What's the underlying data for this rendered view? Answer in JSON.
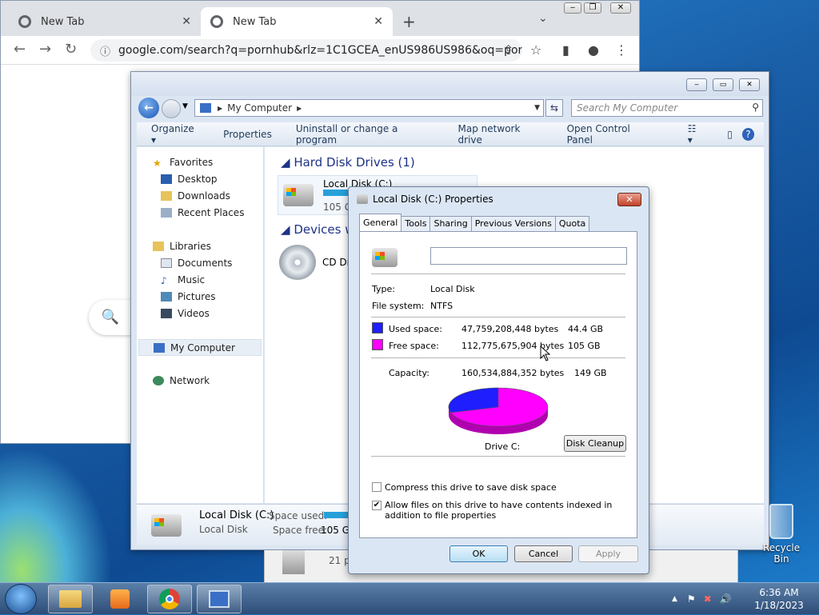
{
  "browser": {
    "tabs": [
      {
        "title": "New Tab"
      },
      {
        "title": "New Tab"
      }
    ],
    "address": "google.com/search?q=pornhub&rlz=1C1GCEA_enUS986US986&oq=porn..."
  },
  "explorer": {
    "breadcrumb": "My Computer",
    "search_placeholder": "Search My Computer",
    "commands": [
      "Organize",
      "Properties",
      "Uninstall or change a program",
      "Map network drive",
      "Open Control Panel"
    ],
    "nav": {
      "favorites": "Favorites",
      "desktop": "Desktop",
      "downloads": "Downloads",
      "recent": "Recent Places",
      "libraries": "Libraries",
      "documents": "Documents",
      "music": "Music",
      "pictures": "Pictures",
      "videos": "Videos",
      "computer": "My Computer",
      "network": "Network"
    },
    "groups": {
      "hdd": "Hard Disk Drives (1)",
      "removable": "Devices with"
    },
    "drive_c": {
      "name": "Local Disk (C:)",
      "size": "105 GB"
    },
    "cd_drive": "CD Dri",
    "details": {
      "name": "Local Disk (C:)",
      "type": "Local Disk",
      "used_label": "Space used:",
      "free_label": "Space free:",
      "free_value": "105 GB"
    },
    "peek": "21 pr"
  },
  "dialog": {
    "title": "Local Disk (C:) Properties",
    "tabs": [
      "General",
      "Tools",
      "Sharing",
      "Previous Versions",
      "Quota"
    ],
    "type_label": "Type:",
    "type_value": "Local Disk",
    "fs_label": "File system:",
    "fs_value": "NTFS",
    "used_label": "Used space:",
    "used_bytes": "47,759,208,448 bytes",
    "used_gb": "44.4 GB",
    "free_label": "Free space:",
    "free_bytes": "112,775,675,904 bytes",
    "free_gb": "105 GB",
    "cap_label": "Capacity:",
    "cap_bytes": "160,534,884,352 bytes",
    "cap_gb": "149 GB",
    "drive_label": "Drive C:",
    "cleanup": "Disk Cleanup",
    "compress": "Compress this drive to save disk space",
    "index": "Allow files on this drive to have contents indexed in addition to file properties",
    "ok": "OK",
    "cancel": "Cancel",
    "apply": "Apply",
    "used_fraction": 0.297,
    "colors": {
      "used": "#1e1eff",
      "free": "#ff00ff"
    }
  },
  "desktop": {
    "recycle_bin": "Recycle Bin"
  },
  "clock": {
    "time": "6:36 AM",
    "date": "1/18/2023"
  }
}
